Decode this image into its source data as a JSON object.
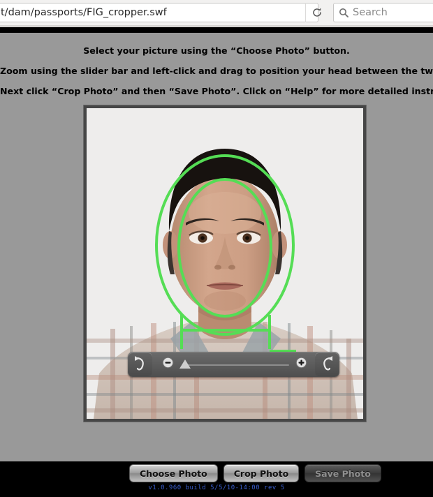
{
  "browser": {
    "url": "t/dam/passports/FIG_cropper.swf",
    "reload_icon": "reload-icon",
    "search_icon": "search-icon",
    "search_placeholder": "Search",
    "search_value": ""
  },
  "app": {
    "instructions": [
      "Select your picture using the “Choose Photo” button.",
      "Zoom using the slider bar and left-click and drag to position your head between the two ovals.",
      "Next click “Crop Photo” and then “Save Photo”.  Click on “Help” for more detailed instructions."
    ],
    "photo": {
      "alt": "passport photo preview of a man in a plaid shirt",
      "guide_oval_color": "#55dd55",
      "background": "#f3f3f2"
    },
    "zoom_toolbar": {
      "rotate_left_icon": "rotate-left-icon",
      "rotate_right_icon": "rotate-right-icon",
      "zoom_out_icon": "minus-circle-icon",
      "zoom_in_icon": "plus-circle-icon",
      "slider_value": 0,
      "slider_min": 0,
      "slider_max": 100
    },
    "buttons": [
      {
        "label": "Choose Photo",
        "state": "enabled",
        "name": "choose-photo-button"
      },
      {
        "label": "Crop Photo",
        "state": "enabled",
        "name": "crop-photo-button"
      },
      {
        "label": "Save Photo",
        "state": "disabled",
        "name": "save-photo-button"
      }
    ],
    "version": "v1.0.960 build 5/5/10-14:00 rev 5",
    "version_color": "#3a5fd0"
  }
}
